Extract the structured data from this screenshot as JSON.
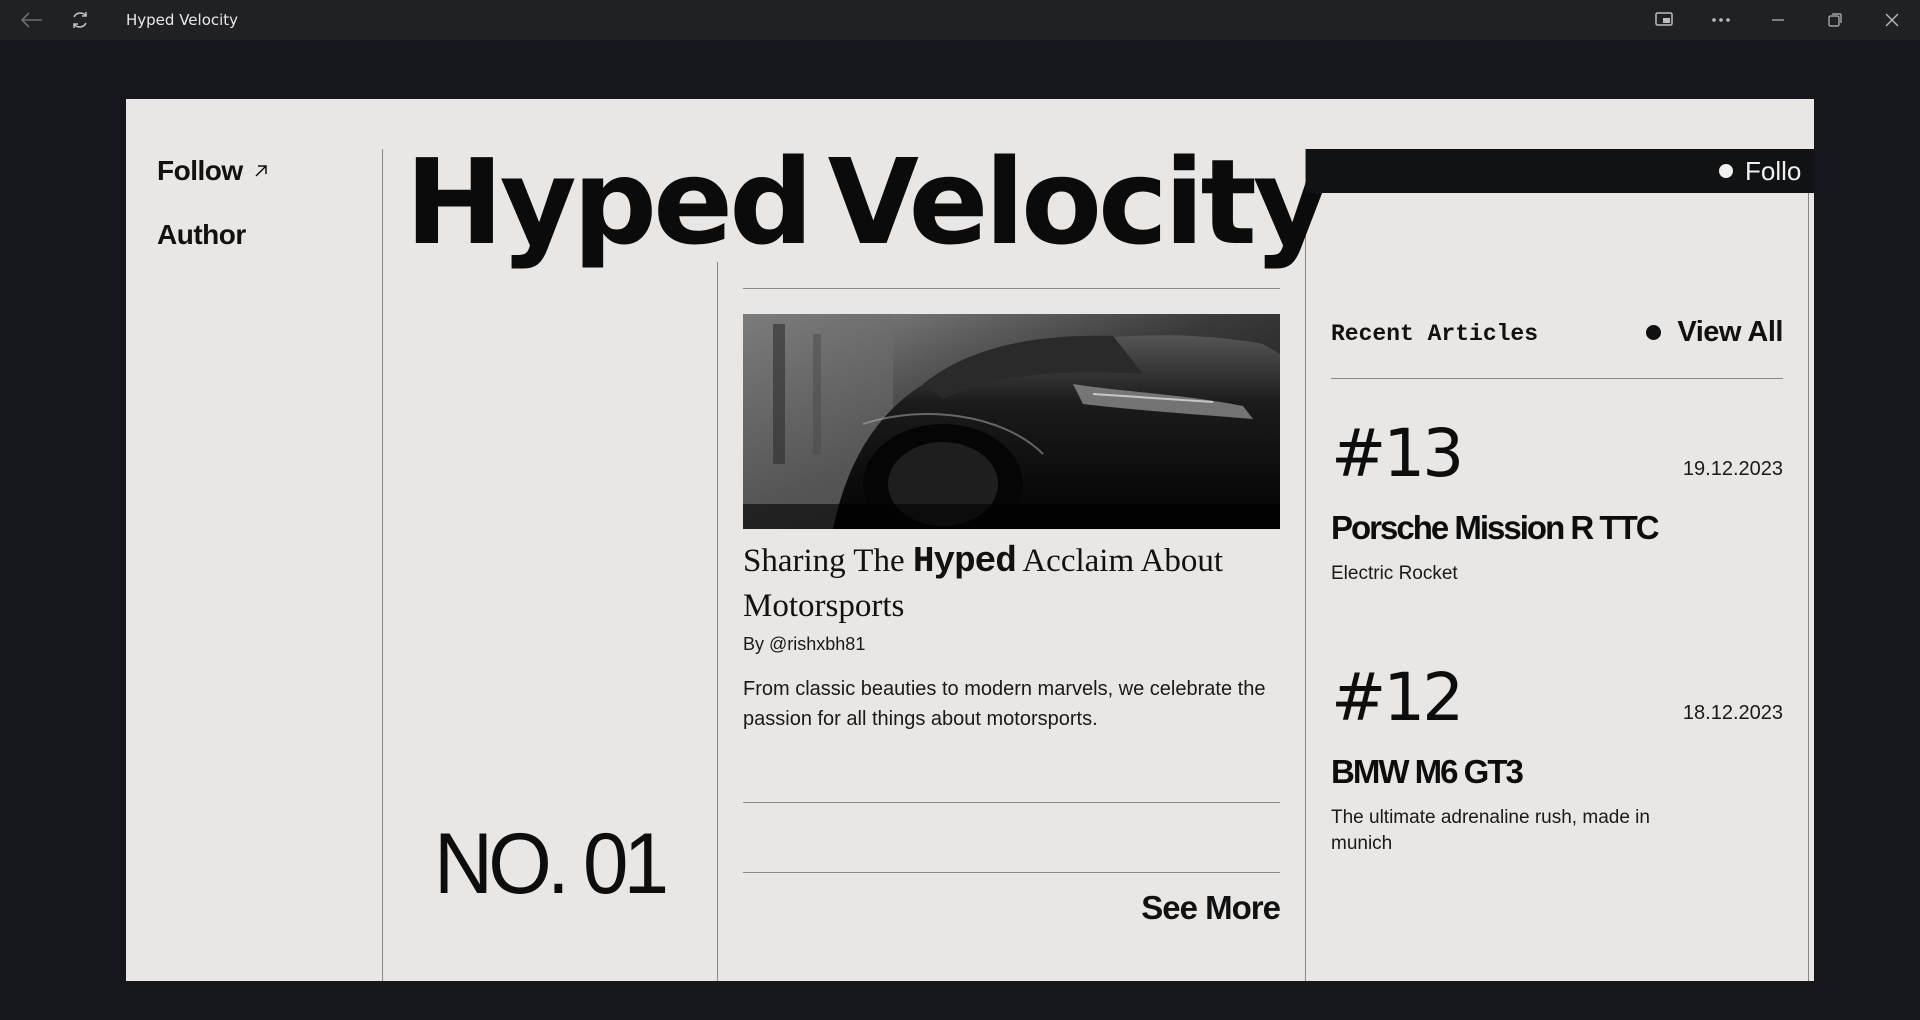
{
  "window": {
    "title": "Hyped Velocity",
    "icons": {
      "back": "back-arrow-icon",
      "refresh": "refresh-icon",
      "cast": "cast-icon",
      "more": "more-icon",
      "minimize": "minimize-icon",
      "restore": "restore-icon",
      "close": "close-icon"
    }
  },
  "nav": {
    "follow": "Follow",
    "author": "Author"
  },
  "hero": {
    "word1": "Hyped",
    "word2": "Velocity"
  },
  "issue": {
    "number": "NO. 01"
  },
  "feature": {
    "title_before": "Sharing The ",
    "title_highlight": "Hyped",
    "title_after": " Acclaim About Motorsports",
    "byline": "By @rishxbh81",
    "description": "From classic beauties to modern marvels, we celebrate the passion for all things about motorsports.",
    "see_more": "See More"
  },
  "ticker": {
    "text": "Follo"
  },
  "recent": {
    "heading": "Recent Articles",
    "view_all": "View All",
    "articles": [
      {
        "number": "#13",
        "date": "19.12.2023",
        "title": "Porsche Mission R TTC",
        "subtitle": "Electric Rocket"
      },
      {
        "number": "#12",
        "date": "18.12.2023",
        "title": "BMW M6 GT3",
        "subtitle": "The ultimate adrenaline rush, made in munich"
      }
    ]
  },
  "colors": {
    "page_bg": "#15171c",
    "titlebar_bg": "#202124",
    "card_bg": "#e9e6e3",
    "ink": "#0d0d0d",
    "rule": "#8a8886"
  }
}
